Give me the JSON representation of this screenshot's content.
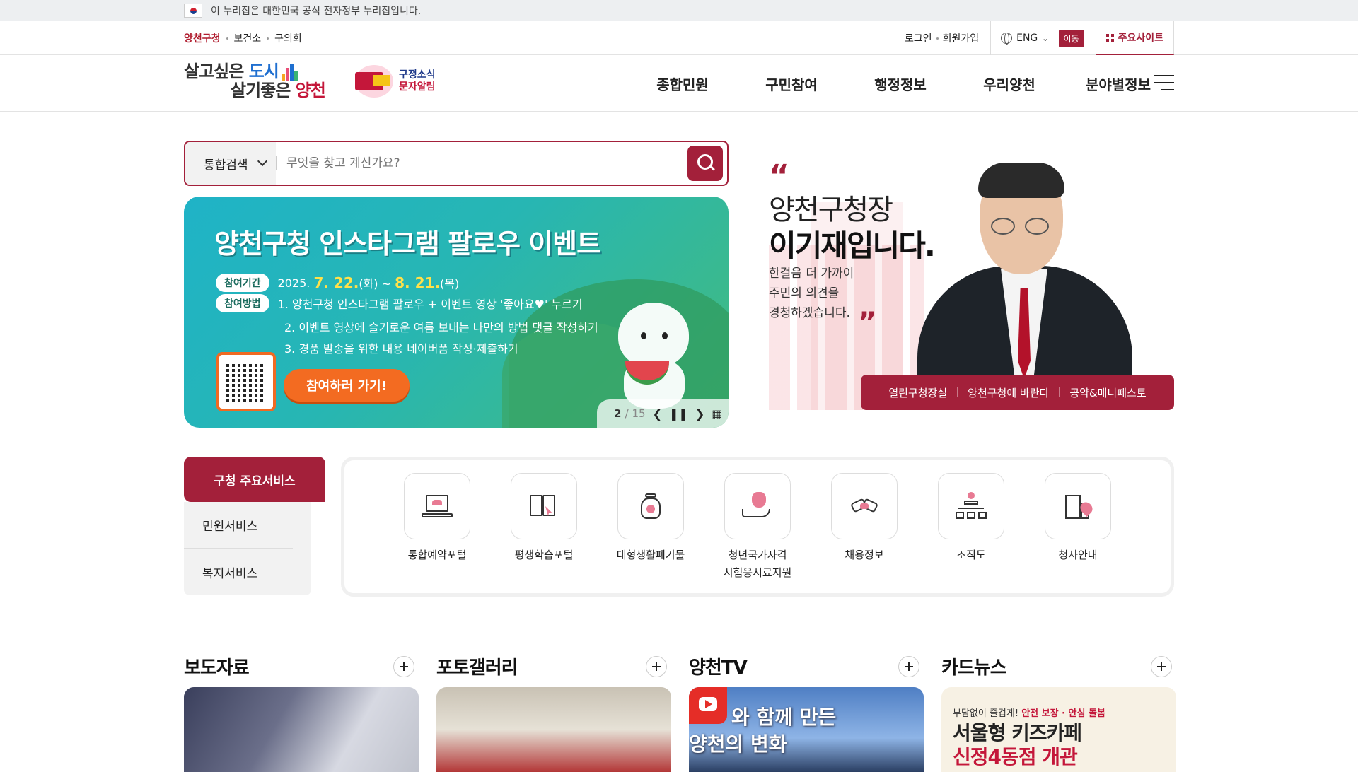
{
  "gov_banner": {
    "text": "이 누리집은 대한민국 공식 전자정부 누리집입니다."
  },
  "util": {
    "left": [
      "양천구청",
      "보건소",
      "구의회"
    ],
    "login": "로그인",
    "join": "회원가입",
    "lang": "ENG",
    "move": "이동",
    "main_sites": "주요사이트"
  },
  "logo": {
    "line1_a": "살고싶은 ",
    "line1_b": "도시",
    "line2_a": "살기좋은 ",
    "line2_b": "양천"
  },
  "sms": {
    "line1": "구정소식",
    "line2": "문자알림"
  },
  "gnb": [
    "종합민원",
    "구민참여",
    "행정정보",
    "우리양천",
    "분야별정보"
  ],
  "search": {
    "scope": "통합검색",
    "placeholder": "무엇을 찾고 계신가요?"
  },
  "banner": {
    "title": "양천구청 인스타그램 팔로우 이벤트",
    "period_label": "참여기간",
    "period_a": "2025.",
    "period_b": "7. 22.",
    "period_c": "(화) ~",
    "period_d": "8. 21.",
    "period_e": "(목)",
    "method_label": "참여방법",
    "step1": "1. 양천구청 인스타그램 팔로우 + 이벤트 영상 '좋아요♥' 누르기",
    "step2": "2. 이벤트 영상에 슬기로운 여름 보내는 나만의 방법 댓글 작성하기",
    "step3": "3. 경품 발송을 위한 내용 네이버폼 작성·제출하기",
    "cta": "참여하러 가기!",
    "pager_current": "2",
    "pager_total": "/ 15"
  },
  "mayor": {
    "line1": "양천구청장",
    "line2": "이기재입니다.",
    "desc1": "한걸음 더 가까이",
    "desc2": "주민의 의견을",
    "desc3": "경청하겠습니다.",
    "links": [
      "열린구청장실",
      "양천구청에 바란다",
      "공약&매니페스토"
    ]
  },
  "services": {
    "tab_active": "구청 주요서비스",
    "tabs": [
      "민원서비스",
      "복지서비스"
    ],
    "items": [
      {
        "label": "통합예약포털",
        "icon": "laptop-icon"
      },
      {
        "label": "평생학습포털",
        "icon": "book-cursor-icon"
      },
      {
        "label": "대형생활폐기물",
        "icon": "recycle-bag-icon"
      },
      {
        "label": "청년국가자격",
        "label2": "시험응시료지원",
        "icon": "money-bag-hand-icon"
      },
      {
        "label": "채용정보",
        "icon": "handshake-icon"
      },
      {
        "label": "조직도",
        "icon": "org-chart-icon"
      },
      {
        "label": "청사안내",
        "icon": "building-pin-icon"
      }
    ]
  },
  "boards": {
    "press": "보도자료",
    "photo": "포토갤러리",
    "tv": "양천TV",
    "card": "카드뉴스",
    "tv_thumb_l1": "와 함께 만든",
    "tv_thumb_l2": "양천의 변화",
    "card_sub_a": "부담없이 즐겁게! ",
    "card_sub_b": "안전 보장 · 안심 돌봄",
    "card_big1": "서울형 키즈카페",
    "card_big2": "신정4동점 개관"
  },
  "colors": {
    "brand": "#a3203a",
    "accent_orange": "#f36b21"
  }
}
